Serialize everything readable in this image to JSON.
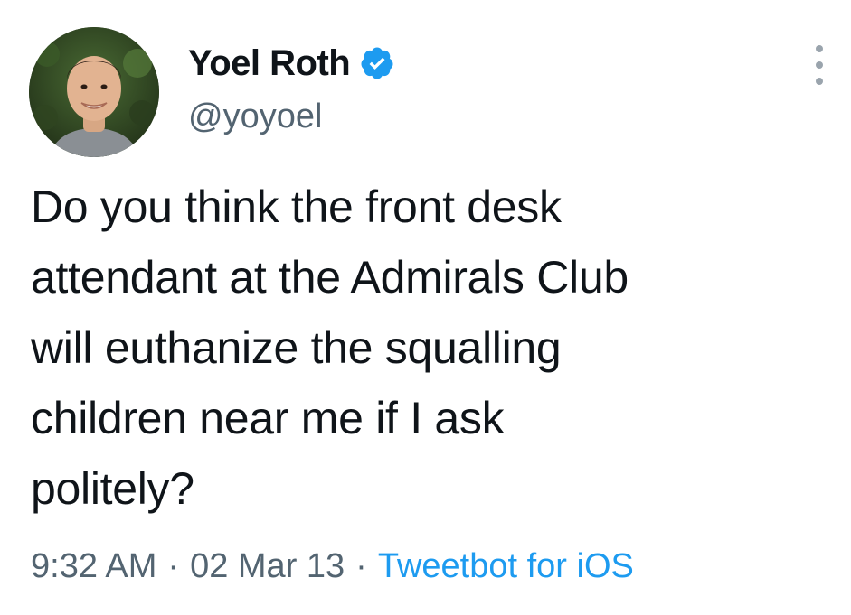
{
  "tweet": {
    "author": {
      "display_name": "Yoel Roth",
      "handle": "@yoyoel",
      "verified": true,
      "avatar_icon": "profile-photo"
    },
    "text_lines": [
      "Do you think the front desk",
      "attendant at the Admirals Club",
      "will euthanize the squalling",
      "children near me if I ask",
      "politely?"
    ],
    "time": "9:32 AM",
    "date": "02 Mar 13",
    "separator": "·",
    "source": "Tweetbot for iOS",
    "more_icon": "more-vertical-icon"
  },
  "colors": {
    "text_primary": "#0f1419",
    "text_secondary": "#536471",
    "link": "#1d9bf0",
    "verified_badge": "#1d9bf0"
  }
}
